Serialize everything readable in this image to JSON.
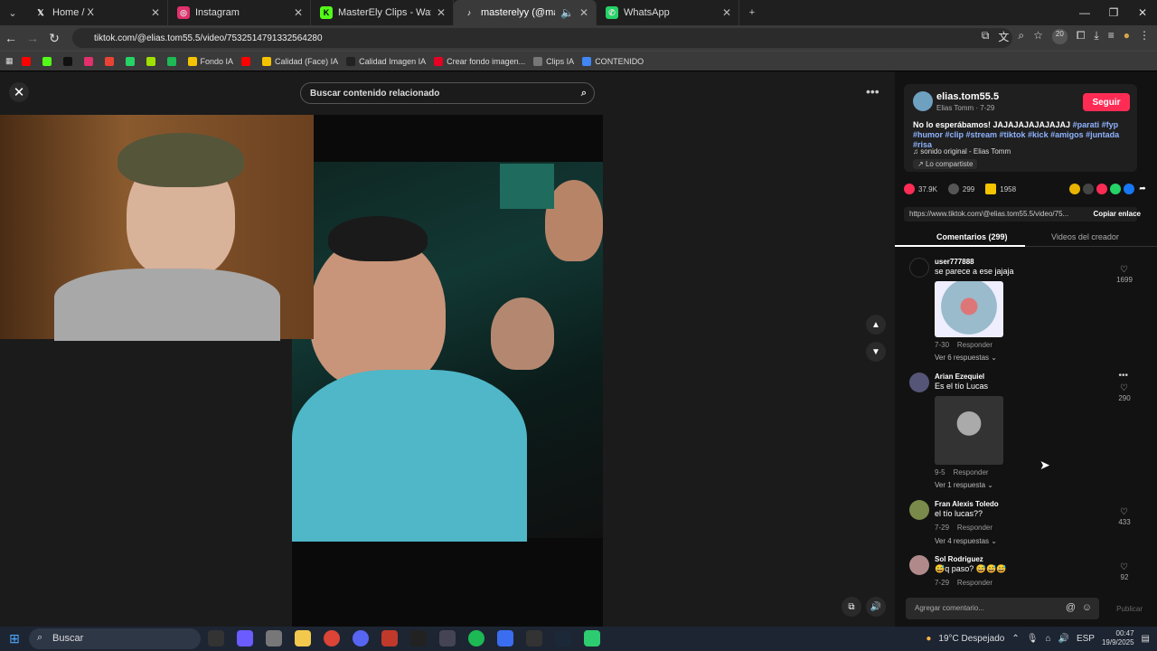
{
  "browser": {
    "tabs": [
      {
        "title": "Home / X",
        "icon": "x-logo-icon",
        "color": "#000000"
      },
      {
        "title": "Instagram",
        "icon": "instagram-icon",
        "color": "#e1306c"
      },
      {
        "title": "MasterEly Clips - Watch Live on",
        "icon": "kick-icon",
        "color": "#53fc18"
      },
      {
        "title": "masterelyy (@masterelyy)",
        "icon": "tiktok-icon",
        "color": "#111111"
      },
      {
        "title": "WhatsApp",
        "icon": "whatsapp-icon",
        "color": "#25d366"
      }
    ],
    "url": "tiktok.com/@elias.tom55.5/video/7532514791332564280",
    "ext_badge": "20",
    "bookmarks": [
      {
        "label": "",
        "color": "#ff0000"
      },
      {
        "label": "",
        "color": "#53fc18"
      },
      {
        "label": "",
        "color": "#111111"
      },
      {
        "label": "",
        "color": "#e1306c"
      },
      {
        "label": "",
        "color": "#ea4335"
      },
      {
        "label": "",
        "color": "#25d366"
      },
      {
        "label": "",
        "color": "#a0e000"
      },
      {
        "label": "",
        "color": "#1db954"
      },
      {
        "label": "Fondo IA",
        "color": "#f5c400"
      },
      {
        "label": "",
        "color": "#ff0000"
      },
      {
        "label": "Calidad (Face) IA",
        "color": "#f5c400"
      },
      {
        "label": "Calidad Imagen IA",
        "color": "#222222"
      },
      {
        "label": "Crear fondo imagen...",
        "color": "#e60023"
      },
      {
        "label": "Clips IA",
        "color": "#777777"
      },
      {
        "label": "CONTENIDO",
        "color": "#4285f4"
      }
    ]
  },
  "player": {
    "search_placeholder": "Buscar contenido relacionado"
  },
  "post": {
    "username": "elias.tom55.5",
    "subtitle": "Elias Tomm · 7-29",
    "follow": "Seguir",
    "caption": "No lo esperábamos! JAJAJAJAJAJAJAJ",
    "hashtags": "#parati #fyp #humor #clip #stream #tiktok #kick #amigos #juntada #risa",
    "music": "sonido original - Elias Tomm",
    "shared": "Lo compartiste",
    "likes": "37.9K",
    "comments": "299",
    "saves": "1958",
    "link": "https://www.tiktok.com/@elias.tom55.5/video/75...",
    "copy_link": "Copiar enlace",
    "tab_comments": "Comentarios (299)",
    "tab_creator": "Videos del creador"
  },
  "comments": [
    {
      "user": "user777888",
      "text": "se parece a ese jajaja",
      "date": "7-30",
      "reply": "Responder",
      "more": "Ver 6 respuestas",
      "likes": "1699",
      "has_image": true,
      "avatar": "#111111",
      "image_color": "#8fb6c4"
    },
    {
      "user": "Arian Ezequiel",
      "text": "Es el tío Lucas",
      "date": "9-5",
      "reply": "Responder",
      "more": "Ver 1 respuesta",
      "likes": "290",
      "has_image": true,
      "avatar": "#555577",
      "image_color": "#3a3a3a"
    },
    {
      "user": "Fran Alexis Toledo",
      "text": "el tío lucas??",
      "date": "7-29",
      "reply": "Responder",
      "more": "Ver 4 respuestas",
      "likes": "433",
      "has_image": false,
      "avatar": "#7a8a4a"
    },
    {
      "user": "Sol Rodriguez",
      "text": "😅q paso? 😅😅😅",
      "date": "7-29",
      "reply": "Responder",
      "more": "",
      "likes": "92",
      "has_image": false,
      "avatar": "#b08a8a"
    }
  ],
  "compose": {
    "placeholder": "Agregar comentario...",
    "publish": "Publicar"
  },
  "taskbar": {
    "search": "Buscar",
    "weather": "19°C  Despejado",
    "lang": "ESP",
    "time": "00:47",
    "date": "19/9/2025"
  }
}
